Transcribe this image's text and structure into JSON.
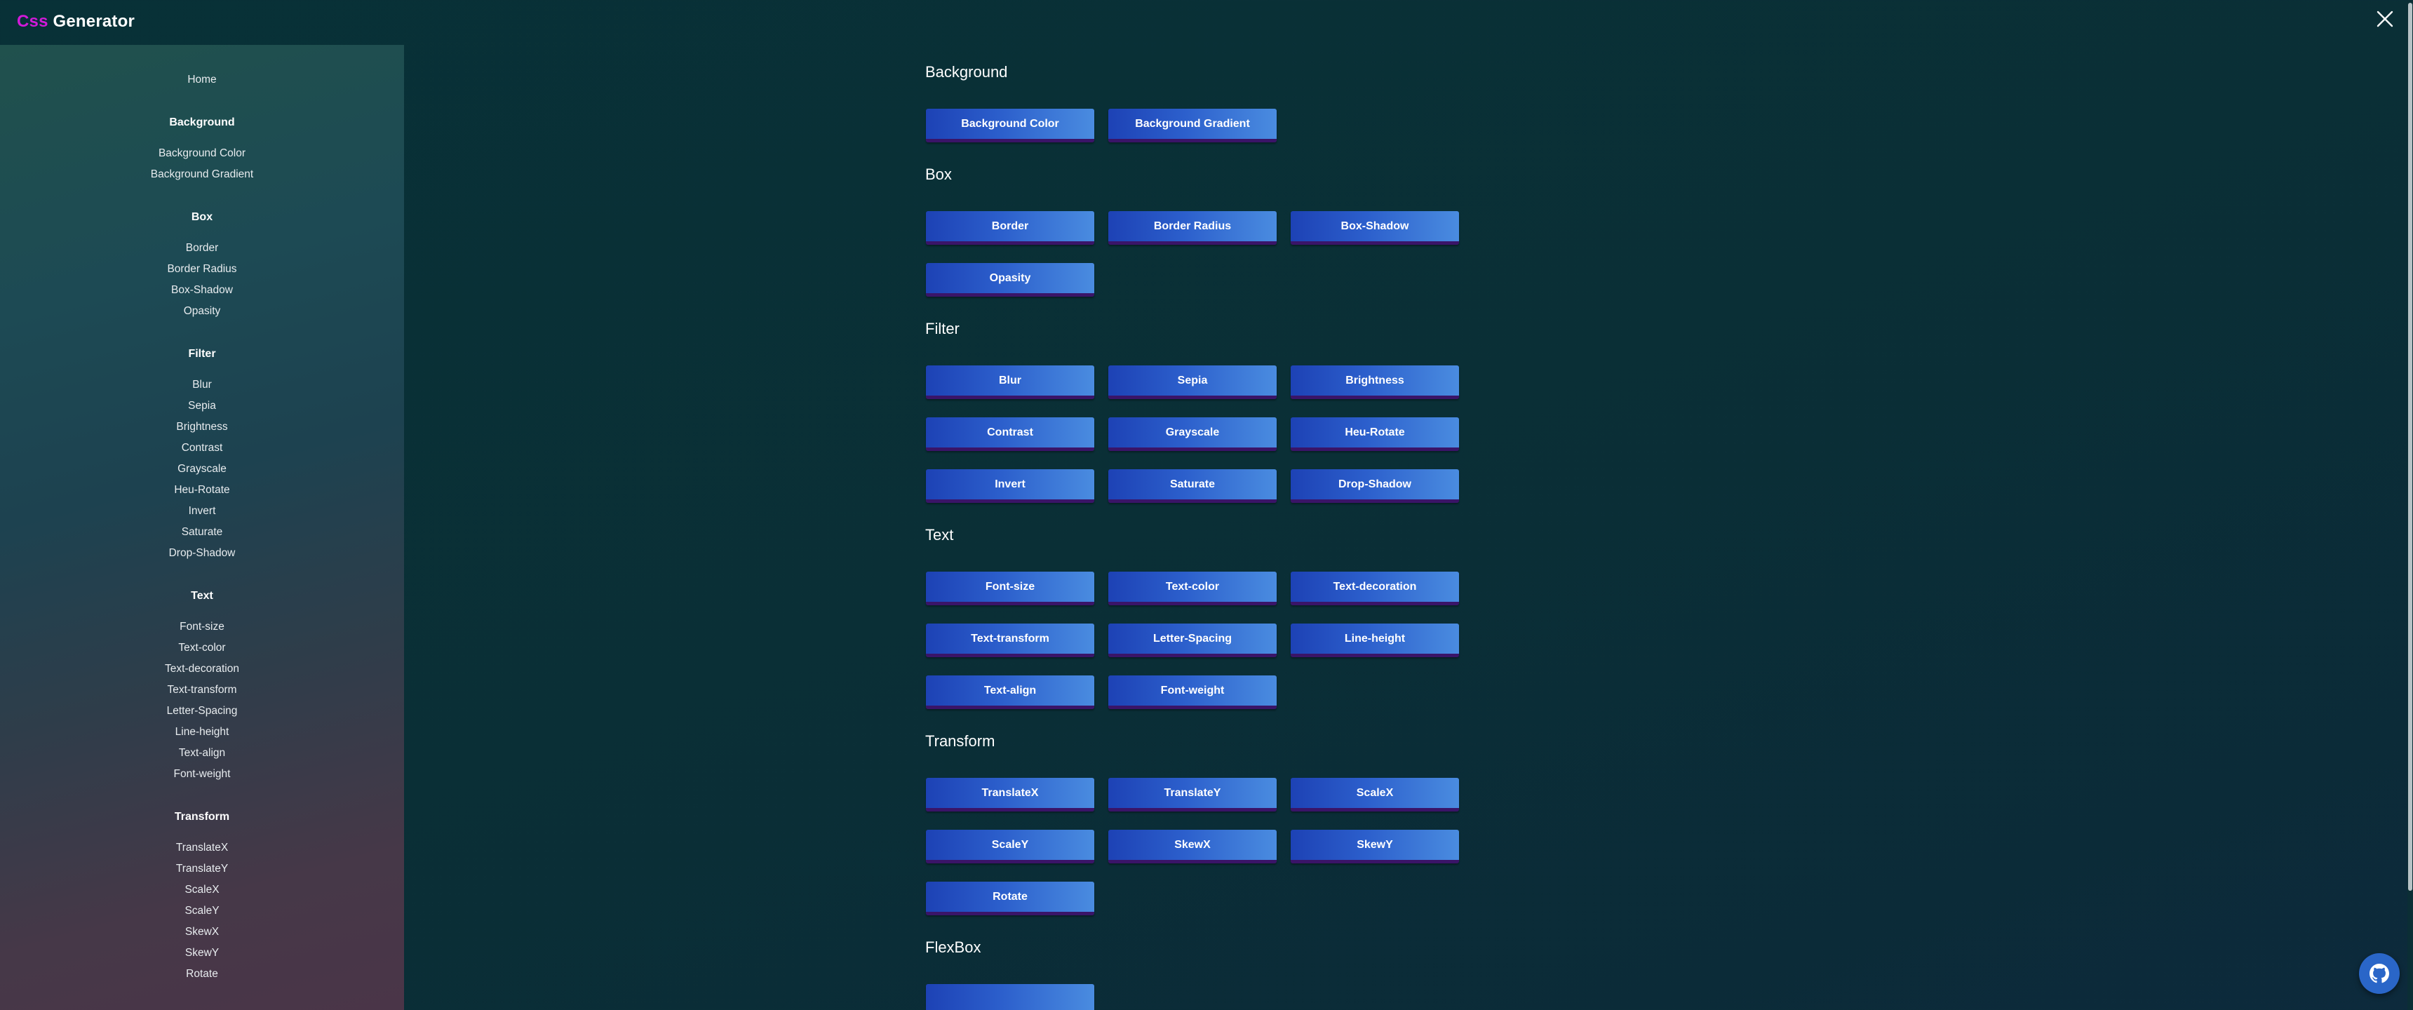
{
  "header": {
    "brand_accent": "Css",
    "brand_main": "Generator"
  },
  "sidebar": {
    "home": "Home",
    "groups": [
      {
        "heading": "Background",
        "items": [
          "Background Color",
          "Background Gradient"
        ]
      },
      {
        "heading": "Box",
        "items": [
          "Border",
          "Border Radius",
          "Box-Shadow",
          "Opasity"
        ]
      },
      {
        "heading": "Filter",
        "items": [
          "Blur",
          "Sepia",
          "Brightness",
          "Contrast",
          "Grayscale",
          "Heu-Rotate",
          "Invert",
          "Saturate",
          "Drop-Shadow"
        ]
      },
      {
        "heading": "Text",
        "items": [
          "Font-size",
          "Text-color",
          "Text-decoration",
          "Text-transform",
          "Letter-Spacing",
          "Line-height",
          "Text-align",
          "Font-weight"
        ]
      },
      {
        "heading": "Transform",
        "items": [
          "TranslateX",
          "TranslateY",
          "ScaleX",
          "ScaleY",
          "SkewX",
          "SkewY",
          "Rotate"
        ]
      }
    ]
  },
  "main": {
    "sections": [
      {
        "title": "Background",
        "buttons": [
          "Background Color",
          "Background Gradient"
        ]
      },
      {
        "title": "Box",
        "buttons": [
          "Border",
          "Border Radius",
          "Box-Shadow",
          "Opasity"
        ]
      },
      {
        "title": "Filter",
        "buttons": [
          "Blur",
          "Sepia",
          "Brightness",
          "Contrast",
          "Grayscale",
          "Heu-Rotate",
          "Invert",
          "Saturate",
          "Drop-Shadow"
        ]
      },
      {
        "title": "Text",
        "buttons": [
          "Font-size",
          "Text-color",
          "Text-decoration",
          "Text-transform",
          "Letter-Spacing",
          "Line-height",
          "Text-align",
          "Font-weight"
        ]
      },
      {
        "title": "Transform",
        "buttons": [
          "TranslateX",
          "TranslateY",
          "ScaleX",
          "ScaleY",
          "SkewX",
          "SkewY",
          "Rotate"
        ]
      },
      {
        "title": "FlexBox",
        "buttons": [
          ""
        ]
      }
    ]
  },
  "colors": {
    "brand_accent": "#d21ad9",
    "button_gradient_start": "#1d42b5",
    "button_gradient_end": "#4a8ce0",
    "button_border": "#3a1468",
    "github_button": "#2a66c8"
  },
  "icons": {
    "close": "close-icon",
    "github": "github-icon"
  }
}
